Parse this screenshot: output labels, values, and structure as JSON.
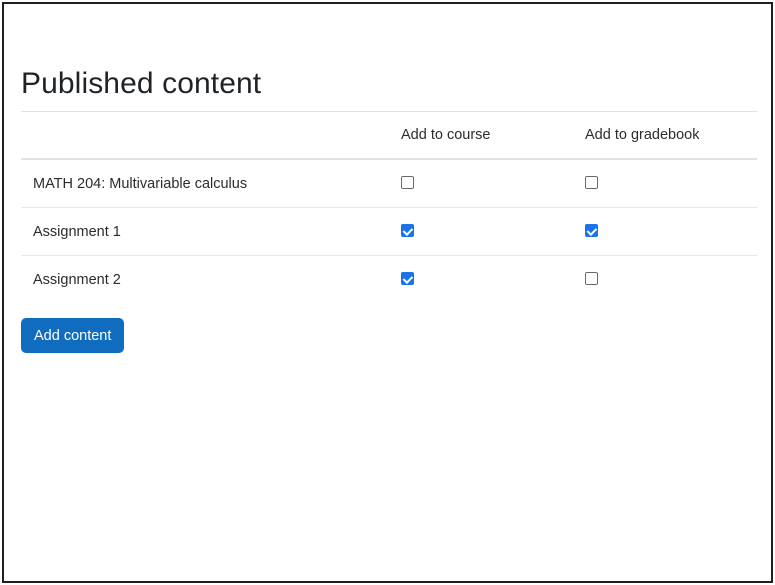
{
  "page": {
    "title": "Published content"
  },
  "table": {
    "headers": [
      "",
      "Add to course",
      "Add to gradebook"
    ],
    "rows": [
      {
        "title": "MATH 204: Multivariable calculus",
        "add_to_course": false,
        "add_to_gradebook": false
      },
      {
        "title": "Assignment 1",
        "add_to_course": true,
        "add_to_gradebook": true
      },
      {
        "title": "Assignment 2",
        "add_to_course": true,
        "add_to_gradebook": false
      }
    ]
  },
  "actions": {
    "add_content_label": "Add content"
  },
  "colors": {
    "accent": "#1a73e8",
    "button": "#0f6cbf"
  }
}
